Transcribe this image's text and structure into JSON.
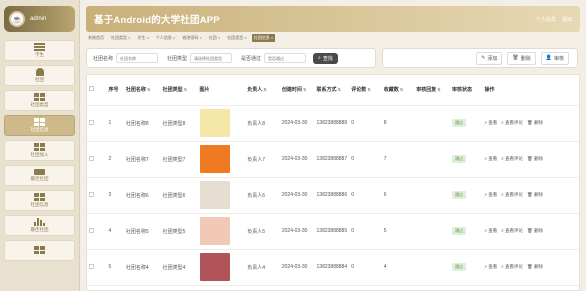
{
  "sidebar": {
    "user": "admin",
    "items": [
      {
        "label": "学生",
        "icon": "list-icon",
        "active": false
      },
      {
        "label": "社团",
        "icon": "bell-icon",
        "active": false
      },
      {
        "label": "社团类型",
        "icon": "grid-icon",
        "active": false
      },
      {
        "label": "社团信息",
        "icon": "grid-icon",
        "active": true
      },
      {
        "label": "社团加入",
        "icon": "grid-icon",
        "active": false
      },
      {
        "label": "最佳社团",
        "icon": "monitor-icon",
        "active": false
      },
      {
        "label": "社团信息",
        "icon": "grid-icon",
        "active": false
      },
      {
        "label": "最佳社团",
        "icon": "bar-chart-icon",
        "active": false
      },
      {
        "label": "",
        "icon": "grid-icon",
        "active": false
      }
    ]
  },
  "header": {
    "title": "基于Android的大学社团APP",
    "links": [
      "个人信息",
      "退出"
    ]
  },
  "tabs": [
    "系统首页",
    "社团类型 ×",
    "学生 ×",
    "个人信息 ×",
    "修改密码 ×",
    "社团 ×",
    "社团类型 ×",
    "社团信息 ×"
  ],
  "filter": {
    "name_label": "社团名称",
    "name_placeholder": "社团名称",
    "type_label": "社团类型",
    "type_placeholder": "请选择社团类型",
    "audit_label": "是否通过",
    "audit_placeholder": "是否通过",
    "search_label": "查找"
  },
  "actions": {
    "add": "添加",
    "delete": "删除",
    "audit": "审核"
  },
  "table": {
    "columns": [
      "序号",
      "社团名称",
      "社团类型",
      "图片",
      "负责人",
      "创建时间",
      "联系方式",
      "评论数",
      "收藏数",
      "审核回复",
      "审核状态",
      "操作"
    ],
    "rows": [
      {
        "index": "1",
        "name": "社团名称8",
        "type": "社团类型8",
        "leader": "负责人8",
        "created": "2024-03-30",
        "phone": "13823888888",
        "comments": "0",
        "favorites": "8",
        "status": "通过",
        "thumb_color": "#f4e7a8"
      },
      {
        "index": "2",
        "name": "社团名称7",
        "type": "社团类型7",
        "leader": "负责人7",
        "created": "2024-03-30",
        "phone": "13823888887",
        "comments": "0",
        "favorites": "7",
        "status": "通过",
        "thumb_color": "#f07a22"
      },
      {
        "index": "3",
        "name": "社团名称6",
        "type": "社团类型6",
        "leader": "负责人6",
        "created": "2024-03-30",
        "phone": "13823888886",
        "comments": "0",
        "favorites": "6",
        "status": "通过",
        "thumb_color": "#e6dccf"
      },
      {
        "index": "4",
        "name": "社团名称5",
        "type": "社团类型5",
        "leader": "负责人5",
        "created": "2024-03-30",
        "phone": "13823888885",
        "comments": "0",
        "favorites": "5",
        "status": "通过",
        "thumb_color": "#f2c9b6"
      },
      {
        "index": "5",
        "name": "社团名称4",
        "type": "社团类型4",
        "leader": "负责人4",
        "created": "2024-03-30",
        "phone": "13823888884",
        "comments": "0",
        "favorites": "4",
        "status": "通过",
        "thumb_color": "#b0545a"
      }
    ],
    "ops": [
      "查看",
      "查看评论",
      "删除"
    ]
  }
}
